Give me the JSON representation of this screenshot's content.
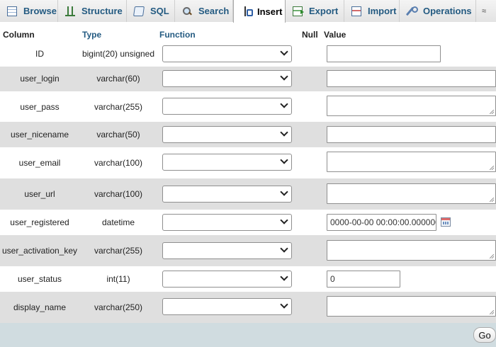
{
  "tabs": [
    {
      "label": "Browse",
      "icon": "browse-icon"
    },
    {
      "label": "Structure",
      "icon": "structure-icon"
    },
    {
      "label": "SQL",
      "icon": "sql-icon"
    },
    {
      "label": "Search",
      "icon": "search-icon"
    },
    {
      "label": "Insert",
      "icon": "insert-icon",
      "active": true
    },
    {
      "label": "Export",
      "icon": "export-icon"
    },
    {
      "label": "Import",
      "icon": "import-icon"
    },
    {
      "label": "Operations",
      "icon": "operations-icon"
    }
  ],
  "more_label": "≈",
  "headers": {
    "column": "Column",
    "type": "Type",
    "function": "Function",
    "null": "Null",
    "value": "Value"
  },
  "fields": [
    {
      "column": "ID",
      "type": "bigint(20) unsigned",
      "function": "",
      "value": "",
      "input": "short"
    },
    {
      "column": "user_login",
      "type": "varchar(60)",
      "function": "",
      "value": "",
      "input": "long"
    },
    {
      "column": "user_pass",
      "type": "varchar(255)",
      "function": "",
      "value": "",
      "input": "textarea"
    },
    {
      "column": "user_nicename",
      "type": "varchar(50)",
      "function": "",
      "value": "",
      "input": "long"
    },
    {
      "column": "user_email",
      "type": "varchar(100)",
      "function": "",
      "value": "",
      "input": "textarea"
    },
    {
      "column": "user_url",
      "type": "varchar(100)",
      "function": "",
      "value": "",
      "input": "textarea"
    },
    {
      "column": "user_registered",
      "type": "datetime",
      "function": "",
      "value": "0000-00-00 00:00:00.000000",
      "input": "datetime"
    },
    {
      "column": "user_activation_key",
      "type": "varchar(255)",
      "function": "",
      "value": "",
      "input": "textarea"
    },
    {
      "column": "user_status",
      "type": "int(11)",
      "function": "",
      "value": "0",
      "input": "medium"
    },
    {
      "column": "display_name",
      "type": "varchar(250)",
      "function": "",
      "value": "",
      "input": "textarea"
    }
  ],
  "go_label": "Go",
  "colors": {
    "tab_text": "#235a81",
    "row_alt": "#dfdfdf",
    "footer": "#d0dce0"
  }
}
